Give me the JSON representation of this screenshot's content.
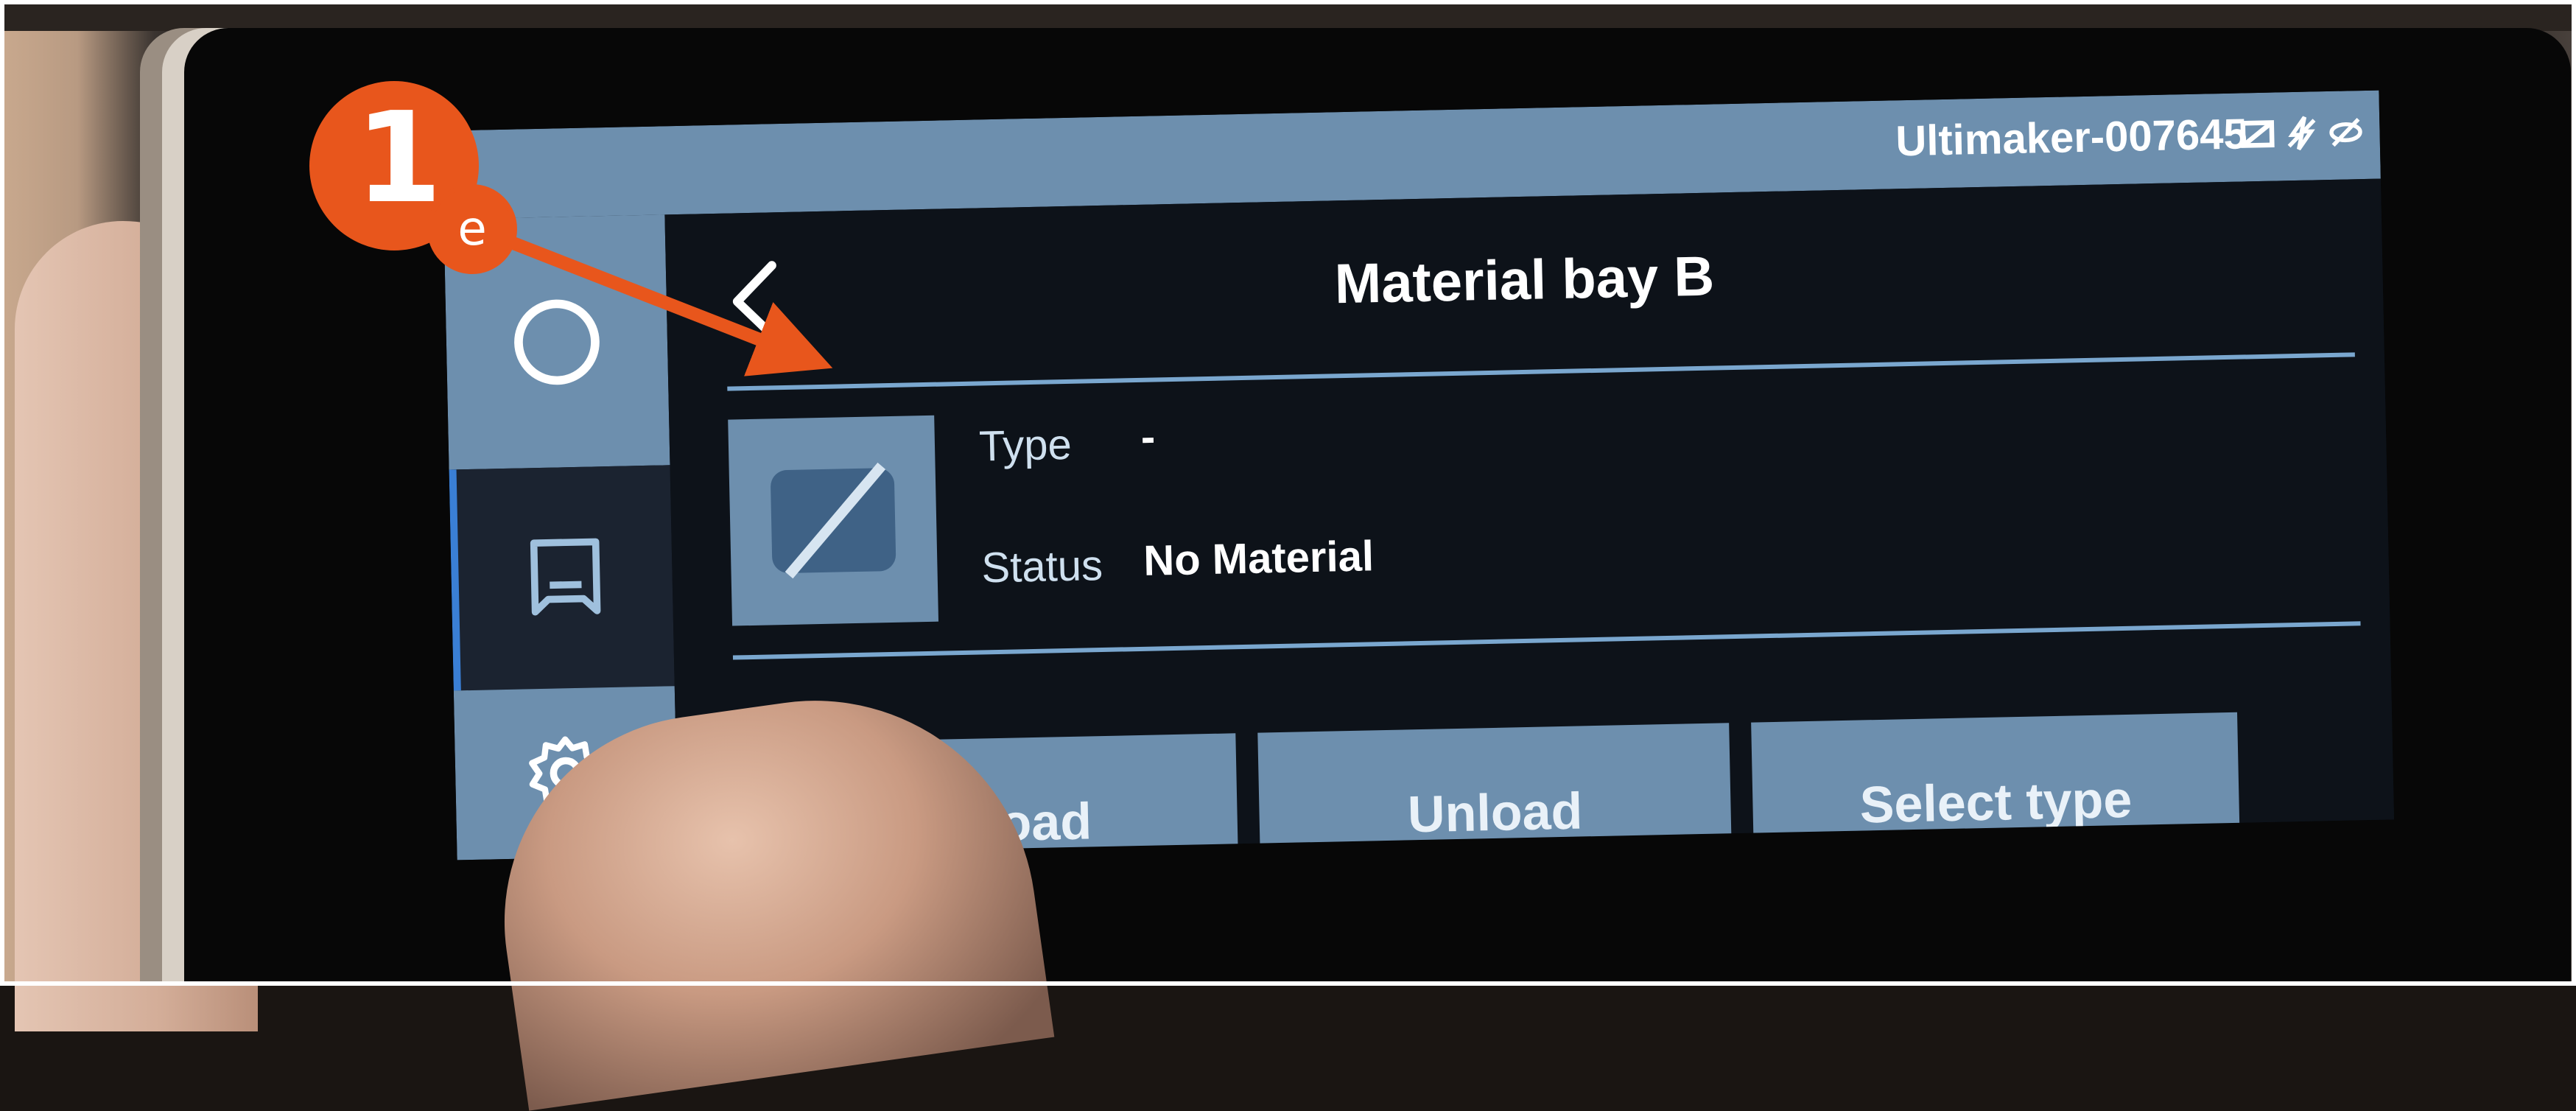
{
  "app": {
    "device_name": "Ultimaker-007645"
  },
  "header": {
    "title": "Material bay B",
    "back_label": "<"
  },
  "sidebar": {
    "items": [
      {
        "name": "home",
        "icon": "circle-icon"
      },
      {
        "name": "material",
        "icon": "material-icon",
        "active": true
      },
      {
        "name": "settings",
        "icon": "gear-icon"
      }
    ]
  },
  "material": {
    "type_label": "Type",
    "type_value": "-",
    "status_label": "Status",
    "status_value": "No Material"
  },
  "actions": {
    "load_label": "Load",
    "load_visible_text": "oad",
    "unload_label": "Unload",
    "select_type_label": "Select type"
  },
  "annotation": {
    "number": "1",
    "letter": "e"
  },
  "colors": {
    "panel": "#6d8fae",
    "screen_bg": "#0d1219",
    "accent": "#3a7fd5",
    "annotation": "#e8561c"
  }
}
